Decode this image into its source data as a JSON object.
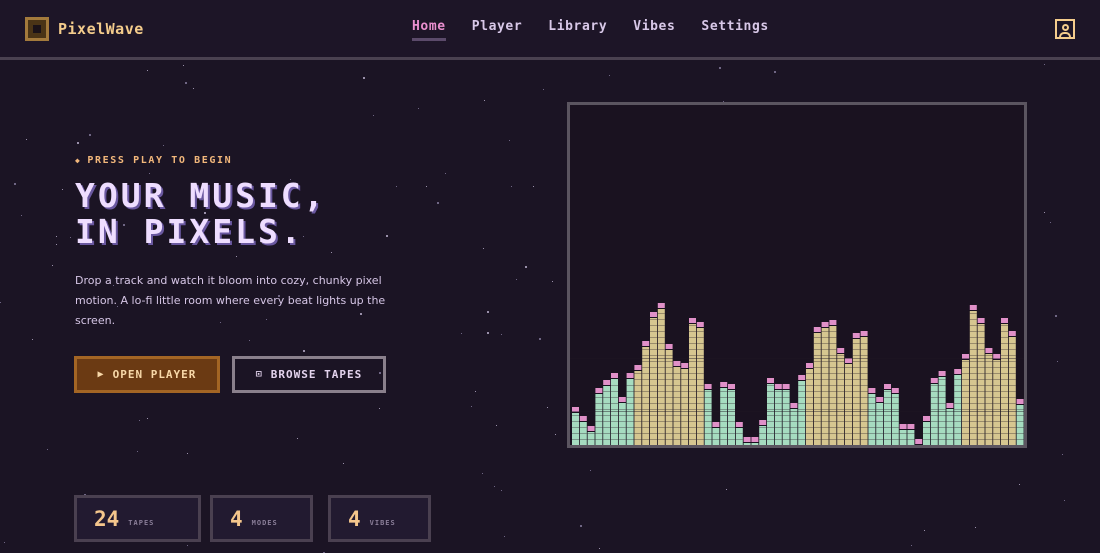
{
  "app": {
    "name": "PixelWave"
  },
  "nav": {
    "items": [
      {
        "label": "Home",
        "active": true
      },
      {
        "label": "Player",
        "active": false
      },
      {
        "label": "Library",
        "active": false
      },
      {
        "label": "Vibes",
        "active": false
      },
      {
        "label": "Settings",
        "active": false
      }
    ],
    "user_icon": "user-icon"
  },
  "hero": {
    "eyebrow": "PRESS PLAY TO BEGIN",
    "title_line1": "YOUR MUSIC,",
    "title_line2": "IN PIXELS.",
    "description": "Drop a track and watch it bloom into cozy, chunky pixel motion. A lo-fi little room where every beat lights up the screen.",
    "primary_button": "OPEN PLAYER",
    "secondary_button": "BROWSE TAPES"
  },
  "stats": [
    {
      "value": "24",
      "label": "TAPES"
    },
    {
      "value": "4",
      "label": "MODES"
    },
    {
      "value": "4",
      "label": "VIBES"
    }
  ],
  "visualizer": {
    "bar_levels": [
      0.15,
      0.11,
      0.06,
      0.24,
      0.28,
      0.31,
      0.2,
      0.31,
      0.35,
      0.46,
      0.6,
      0.64,
      0.45,
      0.37,
      0.36,
      0.57,
      0.55,
      0.26,
      0.08,
      0.27,
      0.26,
      0.08,
      0.01,
      0.01,
      0.09,
      0.29,
      0.26,
      0.26,
      0.17,
      0.3,
      0.36,
      0.53,
      0.55,
      0.56,
      0.43,
      0.38,
      0.5,
      0.51,
      0.24,
      0.2,
      0.26,
      0.24,
      0.07,
      0.07,
      0.0,
      0.11,
      0.29,
      0.32,
      0.17,
      0.33,
      0.4,
      0.63,
      0.57,
      0.43,
      0.4,
      0.57,
      0.51,
      0.19
    ],
    "colors": {
      "low": "#a6dcc0",
      "high": "#d6c690",
      "peak": "#e090c8"
    }
  }
}
